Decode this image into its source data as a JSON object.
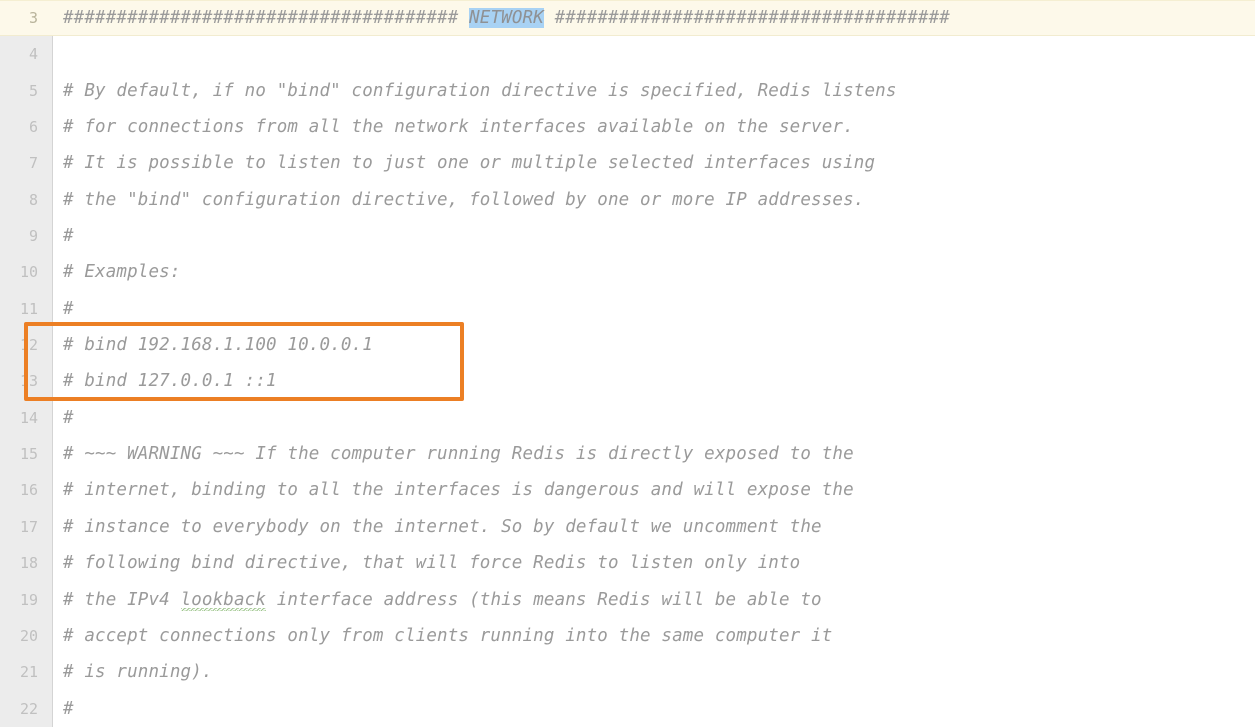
{
  "editor": {
    "app": "code-editor",
    "filename_hint": "redis.conf",
    "gutter_label": "line-numbers",
    "colors": {
      "background": "#ffffff",
      "gutter_background": "#ececec",
      "gutter_border": "#d4d4d4",
      "comment_text": "#9a9a9a",
      "line_number_text": "#c0c0c0",
      "current_line_highlight": "#fdf9ea",
      "selection_highlight": "#a8d2f4",
      "annotation_outline": "#ec7f24",
      "spellcheck_squiggle": "#9cc48a"
    },
    "lines": [
      {
        "num": "3",
        "current": true,
        "segments": [
          {
            "text": "##################################### ",
            "style": "plain"
          },
          {
            "text": "NETWORK",
            "style": "selected"
          },
          {
            "text": " #####################################",
            "style": "plain"
          }
        ]
      },
      {
        "num": "4",
        "current": false,
        "segments": [
          {
            "text": "",
            "style": "plain"
          }
        ]
      },
      {
        "num": "5",
        "current": false,
        "segments": [
          {
            "text": "# By default, if no \"bind\" configuration directive is specified, Redis listens",
            "style": "plain"
          }
        ]
      },
      {
        "num": "6",
        "current": false,
        "segments": [
          {
            "text": "# for connections from all the network interfaces available on the server.",
            "style": "plain"
          }
        ]
      },
      {
        "num": "7",
        "current": false,
        "segments": [
          {
            "text": "# It is possible to listen to just one or multiple selected interfaces using",
            "style": "plain"
          }
        ]
      },
      {
        "num": "8",
        "current": false,
        "segments": [
          {
            "text": "# the \"bind\" configuration directive, followed by one or more IP addresses.",
            "style": "plain"
          }
        ]
      },
      {
        "num": "9",
        "current": false,
        "segments": [
          {
            "text": "#",
            "style": "plain"
          }
        ]
      },
      {
        "num": "10",
        "current": false,
        "segments": [
          {
            "text": "# Examples:",
            "style": "plain"
          }
        ]
      },
      {
        "num": "11",
        "current": false,
        "segments": [
          {
            "text": "#",
            "style": "plain"
          }
        ]
      },
      {
        "num": "12",
        "current": false,
        "segments": [
          {
            "text": "# bind 192.168.1.100 10.0.0.1",
            "style": "plain"
          }
        ]
      },
      {
        "num": "13",
        "current": false,
        "segments": [
          {
            "text": "# bind 127.0.0.1 ::1",
            "style": "plain"
          }
        ]
      },
      {
        "num": "14",
        "current": false,
        "segments": [
          {
            "text": "#",
            "style": "plain"
          }
        ]
      },
      {
        "num": "15",
        "current": false,
        "segments": [
          {
            "text": "# ~~~ WARNING ~~~ If the computer running Redis is directly exposed to the",
            "style": "plain"
          }
        ]
      },
      {
        "num": "16",
        "current": false,
        "segments": [
          {
            "text": "# internet, binding to all the interfaces is dangerous and will expose the",
            "style": "plain"
          }
        ]
      },
      {
        "num": "17",
        "current": false,
        "segments": [
          {
            "text": "# instance to everybody on the internet. So by default we uncomment the",
            "style": "plain"
          }
        ]
      },
      {
        "num": "18",
        "current": false,
        "segments": [
          {
            "text": "# following bind directive, that will force Redis to listen only into",
            "style": "plain"
          }
        ]
      },
      {
        "num": "19",
        "current": false,
        "segments": [
          {
            "text": "# the IPv4 ",
            "style": "plain"
          },
          {
            "text": "lookback",
            "style": "misspelled"
          },
          {
            "text": " interface address (this means Redis will be able to",
            "style": "plain"
          }
        ]
      },
      {
        "num": "20",
        "current": false,
        "segments": [
          {
            "text": "# accept connections only from clients running into the same computer it",
            "style": "plain"
          }
        ]
      },
      {
        "num": "21",
        "current": false,
        "segments": [
          {
            "text": "# is running).",
            "style": "plain"
          }
        ]
      },
      {
        "num": "22",
        "current": false,
        "segments": [
          {
            "text": "#",
            "style": "plain"
          }
        ]
      }
    ],
    "annotation": {
      "label": "bind-examples-highlight",
      "covers_lines": [
        "12",
        "13"
      ],
      "covers_text": [
        "# bind 192.168.1.100 10.0.0.1",
        "# bind 127.0.0.1 ::1"
      ]
    },
    "selection": {
      "text": "NETWORK",
      "on_line": "3"
    },
    "spellcheck": {
      "word": "lookback",
      "on_line": "19"
    }
  }
}
